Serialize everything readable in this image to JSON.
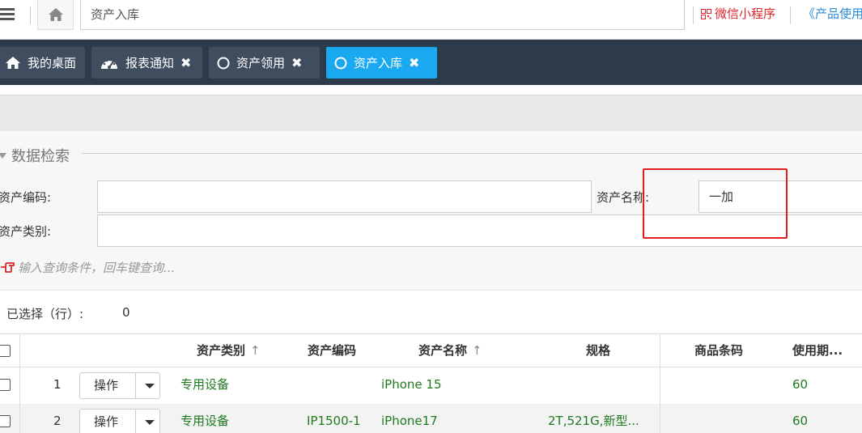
{
  "topbar": {
    "search_text": "资产入库",
    "wechat_label": "微信小程序",
    "manual_label": "《产品使用"
  },
  "tabs": [
    {
      "label": "我的桌面",
      "icon": "home-icon"
    },
    {
      "label": "报表通知",
      "icon": "dashboard-icon"
    },
    {
      "label": "资产领用",
      "icon": "circle-icon"
    },
    {
      "label": "资产入库",
      "icon": "circle-icon"
    }
  ],
  "search_panel": {
    "legend": "数据检索",
    "asset_code_label": "资产编码:",
    "asset_code_value": "",
    "asset_name_label": "资产名称:",
    "asset_name_value": "一加",
    "asset_category_label": "资产类别:",
    "asset_category_value": "",
    "hint": "输入查询条件，回车键查询..."
  },
  "selection": {
    "label": "已选择（行）:",
    "count": "0"
  },
  "table": {
    "columns": [
      "资产类别",
      "资产编码",
      "资产名称",
      "规格",
      "商品条码",
      "使用期..."
    ],
    "sort_arrow": "↑",
    "action_label": "操作",
    "rows": [
      {
        "index": "1",
        "category": "专用设备",
        "code": "",
        "name": "iPhone 15",
        "spec": "",
        "barcode": "",
        "life": "60"
      },
      {
        "index": "2",
        "category": "专用设备",
        "code": "IP1500-1",
        "name": "iPhone17",
        "spec": "2T,521G,新型...",
        "barcode": "",
        "life": "60"
      }
    ]
  },
  "colors": {
    "tabbar_bg": "#2d3a4b",
    "active_tab": "#1aa9f0",
    "green_text": "#1f7a1f",
    "highlight_border": "#e01e1e"
  }
}
